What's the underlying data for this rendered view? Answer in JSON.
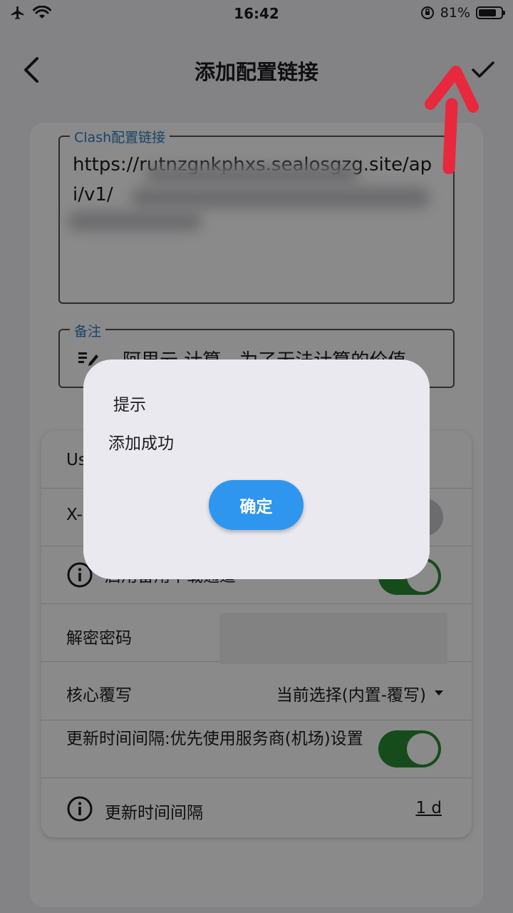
{
  "status_bar": {
    "time": "16:42",
    "battery_percent": "81%",
    "battery_level": 0.81
  },
  "app_bar": {
    "title": "添加配置链接"
  },
  "url_field": {
    "label": "Clash配置链接",
    "value": "https://rutnzgnkphxs.sealosgzg.site/api/v1/"
  },
  "note_field": {
    "label": "备注",
    "value": "阿里云 计算，为了无法计算的价值"
  },
  "settings": {
    "user_agent_label": "Us",
    "x_header_label": "X-",
    "backup_download_label": "启用备用下载通道",
    "backup_download_enabled": true,
    "password_label": "解密密码",
    "core_override_label": "核心覆写",
    "core_override_value": "当前选择(内置-覆写)",
    "provider_interval_label": "更新时间间隔:优先使用服务商(机场)设置",
    "provider_interval_enabled": true,
    "interval_label": "更新时间间隔",
    "interval_value": "1 d"
  },
  "dialog": {
    "title": "提示",
    "message": "添加成功",
    "ok_label": "确定"
  },
  "colors": {
    "accent": "#2e96ef",
    "toggle_on": "#2a8c35",
    "label_blue": "#2f7fc0",
    "annotation_red": "#e8283c"
  }
}
